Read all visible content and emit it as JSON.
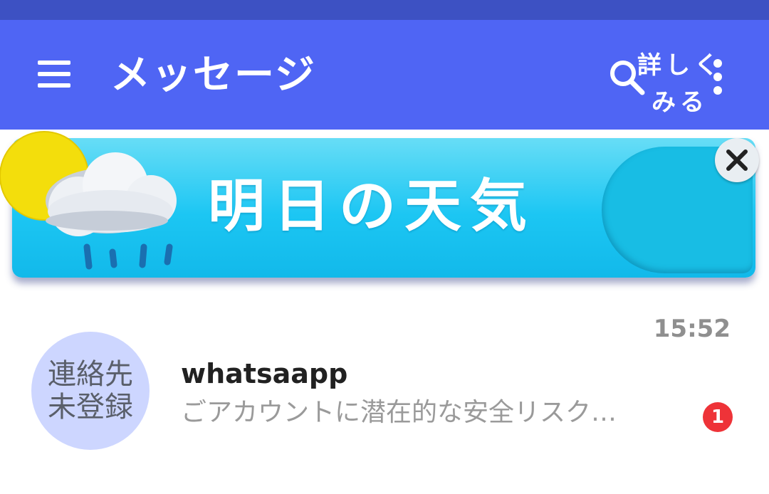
{
  "header": {
    "title": "メッセージ",
    "menu_icon": "hamburger-menu-icon",
    "search_icon": "search-icon",
    "more_icon": "more-vertical-icon",
    "bar_color": "#4f65f4",
    "statusbar_color": "#3d51c3"
  },
  "banner": {
    "title": "明日の天気",
    "button_label": "詳しく\nみる",
    "close_icon": "close-icon",
    "weather_icon": "sun-cloud-rain-icon",
    "color": "#1cc6f3"
  },
  "messages": [
    {
      "avatar_text": "連絡先\n未登録",
      "sender": "whatsaapp",
      "preview": "ごアカウントに潜在的な安全リスク…",
      "time": "15:52",
      "unread_count": "1"
    }
  ]
}
